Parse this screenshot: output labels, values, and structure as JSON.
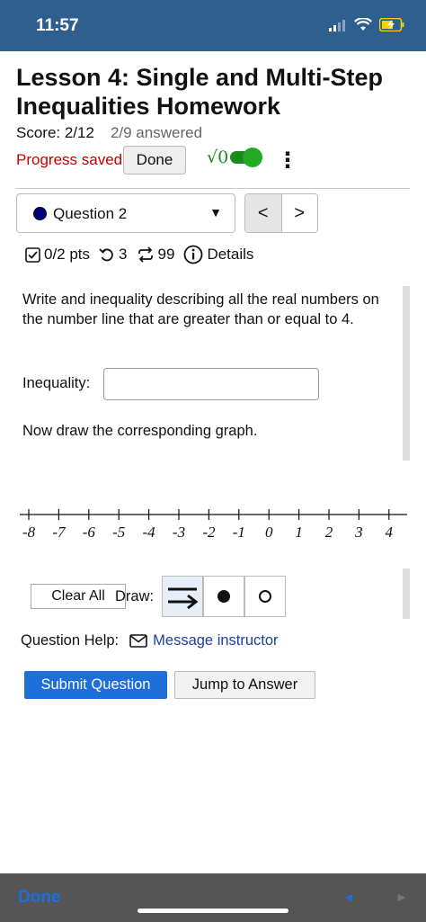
{
  "status_bar": {
    "time": "11:57"
  },
  "header": {
    "title": "Lesson 4: Single and Multi-Step Inequalities Homework",
    "score": "Score: 2/12",
    "answered": "2/9 answered",
    "progress_saved": "Progress saved",
    "done_label": "Done",
    "math_toggle_label": "√0",
    "math_toggle_on": true
  },
  "question_nav": {
    "selected_question": "Question 2",
    "prev_label": "<",
    "next_label": ">"
  },
  "meta": {
    "points": "0/2 pts",
    "attempts": "3",
    "retries": "99",
    "details_label": "Details"
  },
  "question": {
    "prompt": "Write and inequality describing all the real numbers on the number line that are greater than or equal to 4.",
    "inequality_label": "Inequality:",
    "inequality_value": "",
    "draw_instruction": "Now draw the corresponding graph."
  },
  "number_line": {
    "ticks": [
      "-8",
      "-7",
      "-6",
      "-5",
      "-4",
      "-3",
      "-2",
      "-1",
      "0",
      "1",
      "2",
      "3",
      "4"
    ]
  },
  "graph_tools": {
    "clear_all_label": "Clear All",
    "draw_label": "Draw:",
    "tools": [
      "ray-tool-icon",
      "closed-dot-icon",
      "open-dot-icon"
    ],
    "selected_tool": "ray-tool-icon"
  },
  "help": {
    "label": "Question Help:",
    "message_link": "Message instructor"
  },
  "actions": {
    "submit_label": "Submit Question",
    "jump_label": "Jump to Answer"
  },
  "bottom_bar": {
    "done_label": "Done",
    "prev_label": "◄",
    "next_label": "►"
  },
  "colors": {
    "header_bg": "#2f5f8f",
    "progress_saved": "#c40000",
    "toggle_green": "#1b8a1b",
    "primary_button": "#1e6fd9",
    "link": "#1a3f9e"
  }
}
